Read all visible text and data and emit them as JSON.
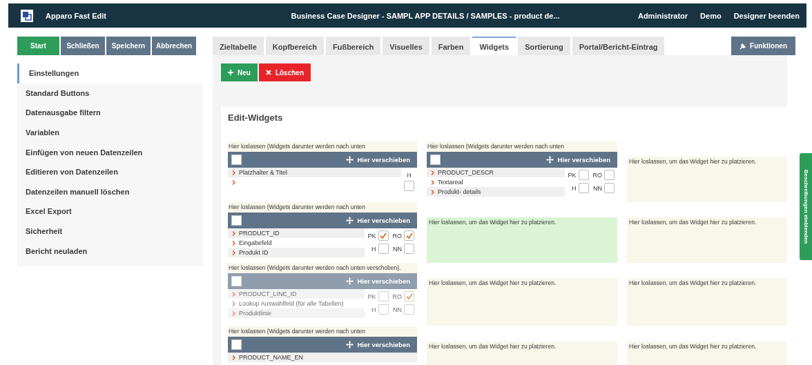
{
  "header": {
    "app_name": "Apparo Fast Edit",
    "title": "Business Case Designer - SAMPL APP DETAILS / SAMPLES - product de...",
    "links": [
      "Administrator",
      "Demo",
      "Designer beenden"
    ]
  },
  "actions": [
    {
      "label": "Start",
      "kind": "primary"
    },
    {
      "label": "Schließen",
      "kind": "secondary"
    },
    {
      "label": "Speichern",
      "kind": "secondary"
    },
    {
      "label": "Abbrechen",
      "kind": "secondary"
    }
  ],
  "tabs": [
    {
      "label": "Zieltabelle",
      "selected": false
    },
    {
      "label": "Kopfbereich",
      "selected": false
    },
    {
      "label": "Fußbereich",
      "selected": false
    },
    {
      "label": "Visuelles",
      "selected": false
    },
    {
      "label": "Farben",
      "selected": false
    },
    {
      "label": "Widgets",
      "selected": true
    },
    {
      "label": "Sortierung",
      "selected": false
    },
    {
      "label": "Portal/Bericht-Eintrag",
      "selected": false
    }
  ],
  "functions_button": {
    "label": "Funktionen"
  },
  "sidebar": {
    "items": [
      {
        "label": "Einstellungen",
        "selected": true
      },
      {
        "label": "Standard Buttons",
        "selected": false
      },
      {
        "label": "Datenausgabe filtern",
        "selected": false
      },
      {
        "label": "Variablen",
        "selected": false
      },
      {
        "label": "Einfügen von neuen Datenzeilen",
        "selected": false
      },
      {
        "label": "Editieren von Datenzeilen",
        "selected": false
      },
      {
        "label": "Datenzeilen manuell löschen",
        "selected": false
      },
      {
        "label": "Excel Export",
        "selected": false
      },
      {
        "label": "Sicherheit",
        "selected": false
      },
      {
        "label": "Bericht neuladen",
        "selected": false
      }
    ]
  },
  "toolbar": [
    {
      "label": "Neu",
      "kind": "add"
    },
    {
      "label": "Löschen",
      "kind": "delete"
    }
  ],
  "editor": {
    "title": "Edit-Widgets",
    "rows": [
      {
        "cells": [
          {
            "kind": "widget",
            "hint": "Hier loslassen (Widgets darunter werden nach unten",
            "widget": {
              "kind": "placeholder",
              "selected": false,
              "handle": "Hier verschieben",
              "lines": [
                "Platzhalter & Titel"
              ],
              "flags": [
                {
                  "label": "H",
                  "checked": false
                }
              ]
            }
          },
          {
            "kind": "widget",
            "hint": "Hier loslassen (Widgets darunter werden nach unten",
            "widget": {
              "kind": "field",
              "selected": false,
              "handle": "Hier verschieben",
              "lines": [
                "PRODUCT_DESCR",
                "Textareal",
                "Produkt- details"
              ],
              "flags": [
                {
                  "label": "PK",
                  "checked": false
                },
                {
                  "label": "RO",
                  "checked": false
                },
                {
                  "label": "H",
                  "checked": false
                },
                {
                  "label": "NN",
                  "checked": false
                }
              ]
            }
          },
          {
            "kind": "zone",
            "text": "Hier loslassen, um das Widget hier zu platzieren.",
            "highlighted": false
          }
        ]
      },
      {
        "cells": [
          {
            "kind": "widget",
            "hint": "Hier loslassen (Widgets darunter werden nach unten",
            "widget": {
              "kind": "field",
              "selected": false,
              "handle": "Hier verschieben",
              "lines": [
                "PRODUCT_ID",
                "Eingabefeld",
                "Produkt ID"
              ],
              "flags": [
                {
                  "label": "PK",
                  "checked": true
                },
                {
                  "label": "RO",
                  "checked": true
                },
                {
                  "label": "H",
                  "checked": false
                },
                {
                  "label": "NN",
                  "checked": false
                }
              ]
            }
          },
          {
            "kind": "zone",
            "text": "Hier loslassen, um das Widget hier zu platzieren.",
            "highlighted": true
          },
          {
            "kind": "zone",
            "text": "Hier loslassen, um das Widget hier zu platzieren.",
            "highlighted": false
          }
        ]
      },
      {
        "cells": [
          {
            "kind": "hint",
            "hint": "Hier loslassen (Widgets darunter werden nach unten verschoben)."
          },
          {
            "kind": "zone",
            "text": "Hier loslassen, um das Widget hier zu platzieren.",
            "highlighted": false
          },
          {
            "kind": "zone",
            "text": "Hier loslassen, um das Widget hier zu platzieren.",
            "highlighted": false
          }
        ]
      },
      {
        "cells": [
          {
            "kind": "widget",
            "hint": "Hier loslassen (Widgets darunter werden nach unten",
            "widget": {
              "kind": "field",
              "selected": false,
              "handle": "Hier verschieben",
              "lines": [
                "PRODUCT_NAME_EN"
              ]
            }
          },
          {
            "kind": "zone",
            "text": "Hier loslassen, um das Widget hier zu platzieren.",
            "highlighted": false
          },
          {
            "kind": "zone",
            "text": "Hier loslassen, um das Widget hier zu platzieren.",
            "highlighted": false
          }
        ]
      }
    ]
  },
  "dragged_widget": {
    "kind": "field",
    "selected": false,
    "handle": "Hier verschieben",
    "lines": [
      "PRODUCT_LINE_ID",
      "Lookup Auswahlfeld (für alle Tabellen)",
      "Produktlinie"
    ],
    "flags": [
      {
        "label": "PK",
        "checked": false
      },
      {
        "label": "RO",
        "checked": true
      },
      {
        "label": "H",
        "checked": false
      },
      {
        "label": "NN",
        "checked": false
      }
    ]
  },
  "side_tab": {
    "label": "Beschreibungen einblenden"
  }
}
